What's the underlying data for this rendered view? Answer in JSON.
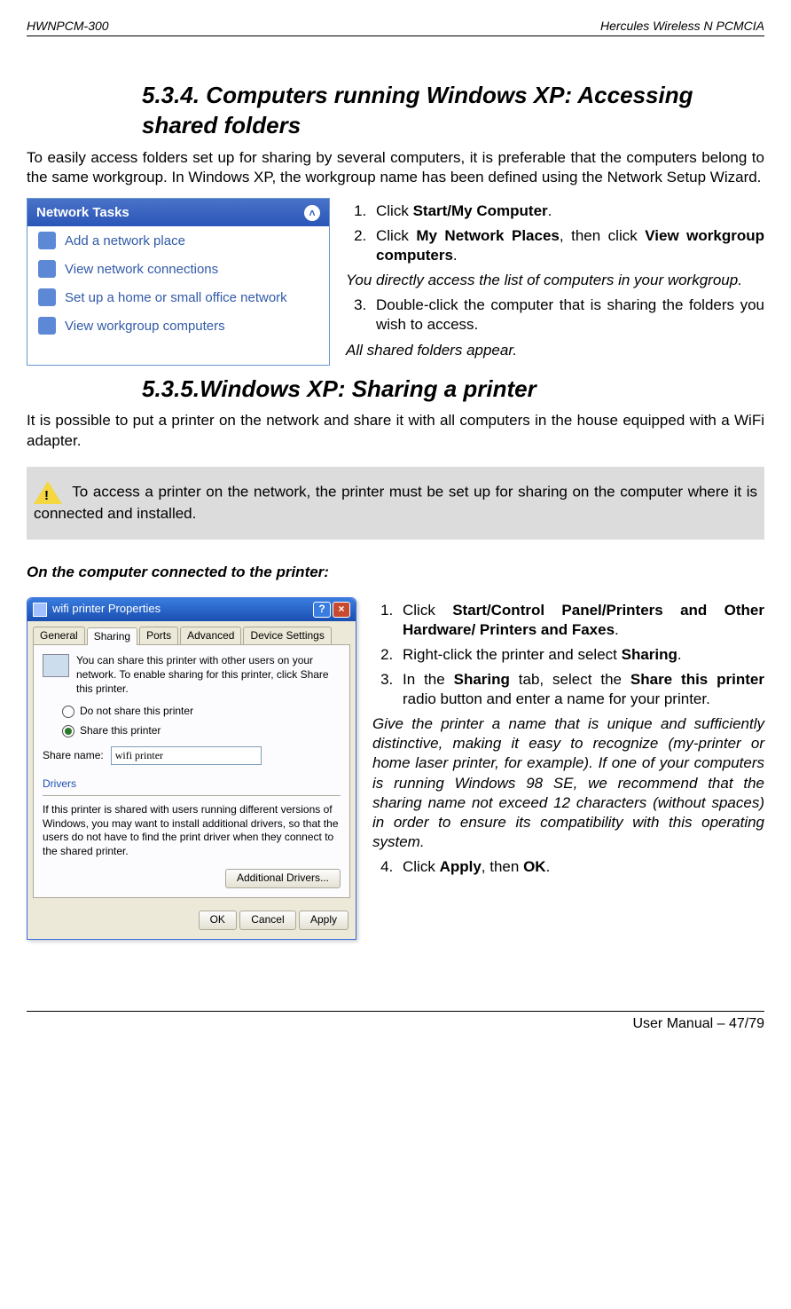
{
  "header": {
    "left": "HWNPCM-300",
    "right": "Hercules Wireless N PCMCIA"
  },
  "footer": "User Manual – 47/79",
  "sec534": {
    "num": "5.3.4.",
    "title_rest": " Computers running Windows XP: Accessing shared folders",
    "intro": "To easily access folders set up for sharing by several computers, it is preferable that the computers belong to the same workgroup.  In Windows XP, the workgroup name has been defined using the Network Setup Wizard.",
    "steps": {
      "s1_pre": "Click ",
      "s1_b": "Start/My Computer",
      "s1_post": ".",
      "s2_pre": "Click ",
      "s2_b1": "My Network Places",
      "s2_mid": ", then click ",
      "s2_b2": "View workgroup computers",
      "s2_post": ".",
      "note1": "You directly access the list of computers in your workgroup.",
      "s3": "Double-click the computer that is sharing the folders you wish to access.",
      "note2": "All shared folders appear."
    }
  },
  "netTasks": {
    "title": "Network Tasks",
    "items": [
      "Add a network place",
      "View network connections",
      "Set up a home or small office network",
      "View workgroup computers"
    ]
  },
  "sec535": {
    "num": "5.3.5.",
    "title_rest": "Windows XP: Sharing a printer",
    "intro": "It is possible to put a printer on the network and share it with all computers in the house equipped with a WiFi adapter.",
    "warn": " To access a printer on the network, the printer must be set up for sharing on the computer where it is connected and installed.",
    "sub": "On the computer connected to the printer:",
    "steps": {
      "s1_pre": "Click ",
      "s1_b": "Start/Control Panel/Printers and Other Hardware/ Printers and Faxes",
      "s1_post": ".",
      "s2_pre": "Right-click the printer and select ",
      "s2_b": "Sharing",
      "s2_post": ".",
      "s3_pre": "In the ",
      "s3_b1": "Sharing",
      "s3_mid": " tab, select the ",
      "s3_b2": "Share this printer",
      "s3_post": " radio button and enter a name for your printer.",
      "note": "Give the printer a name that is unique and sufficiently distinctive, making it easy to recognize (my-printer or home laser printer, for example).  If one of your computers is running Windows 98 SE, we recommend that the sharing name not exceed 12 characters (without spaces) in order to ensure its compatibility with this operating system.",
      "s4_pre": "Click ",
      "s4_b1": "Apply",
      "s4_mid": ", then ",
      "s4_b2": "OK",
      "s4_post": "."
    }
  },
  "props": {
    "title": "wifi printer Properties",
    "tabs": [
      "General",
      "Sharing",
      "Ports",
      "Advanced",
      "Device Settings"
    ],
    "desc": "You can share this printer with other users on your network. To enable sharing for this printer, click Share this printer.",
    "radio_no": "Do not share this printer",
    "radio_yes": "Share this printer",
    "share_label": "Share name:",
    "share_value": "wifi printer",
    "drivers_title": "Drivers",
    "drivers_desc": "If this printer is shared with users running different versions of Windows, you may want to install additional drivers, so that the users do not have to find the print driver when they connect to the shared printer.",
    "btn_add": "Additional Drivers...",
    "btn_ok": "OK",
    "btn_cancel": "Cancel",
    "btn_apply": "Apply"
  }
}
